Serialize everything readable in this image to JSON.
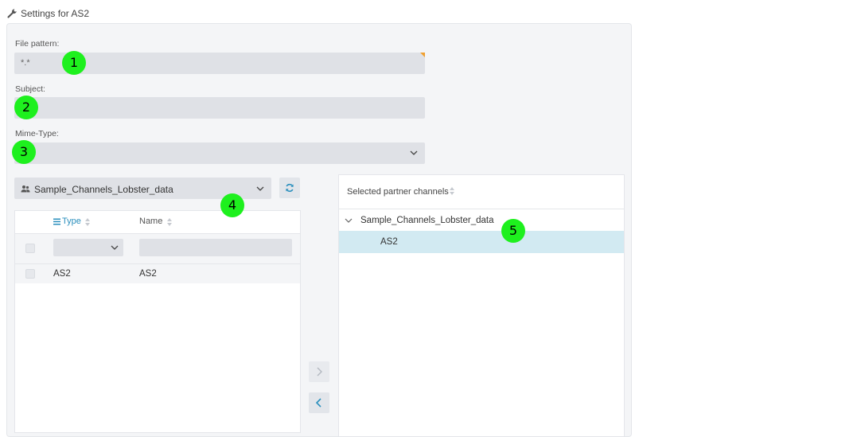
{
  "header": {
    "title": "Settings for AS2"
  },
  "form": {
    "file_pattern": {
      "label": "File pattern:",
      "value": "*.*"
    },
    "subject": {
      "label": "Subject:",
      "value": ""
    },
    "mime_type": {
      "label": "Mime-Type:",
      "value": ""
    }
  },
  "left": {
    "group_select": "Sample_Channels_Lobster_data",
    "columns": {
      "type": "Type",
      "name": "Name"
    },
    "rows": [
      {
        "type": "AS2",
        "name": "AS2"
      }
    ]
  },
  "right": {
    "header": "Selected partner channels",
    "group": "Sample_Channels_Lobster_data",
    "items": [
      "AS2"
    ]
  },
  "markers": [
    "1",
    "2",
    "3",
    "4",
    "5"
  ],
  "colors": {
    "accent": "#2a8fbd",
    "selected_row": "#d2eaf2",
    "marker": "#1ef01e"
  }
}
